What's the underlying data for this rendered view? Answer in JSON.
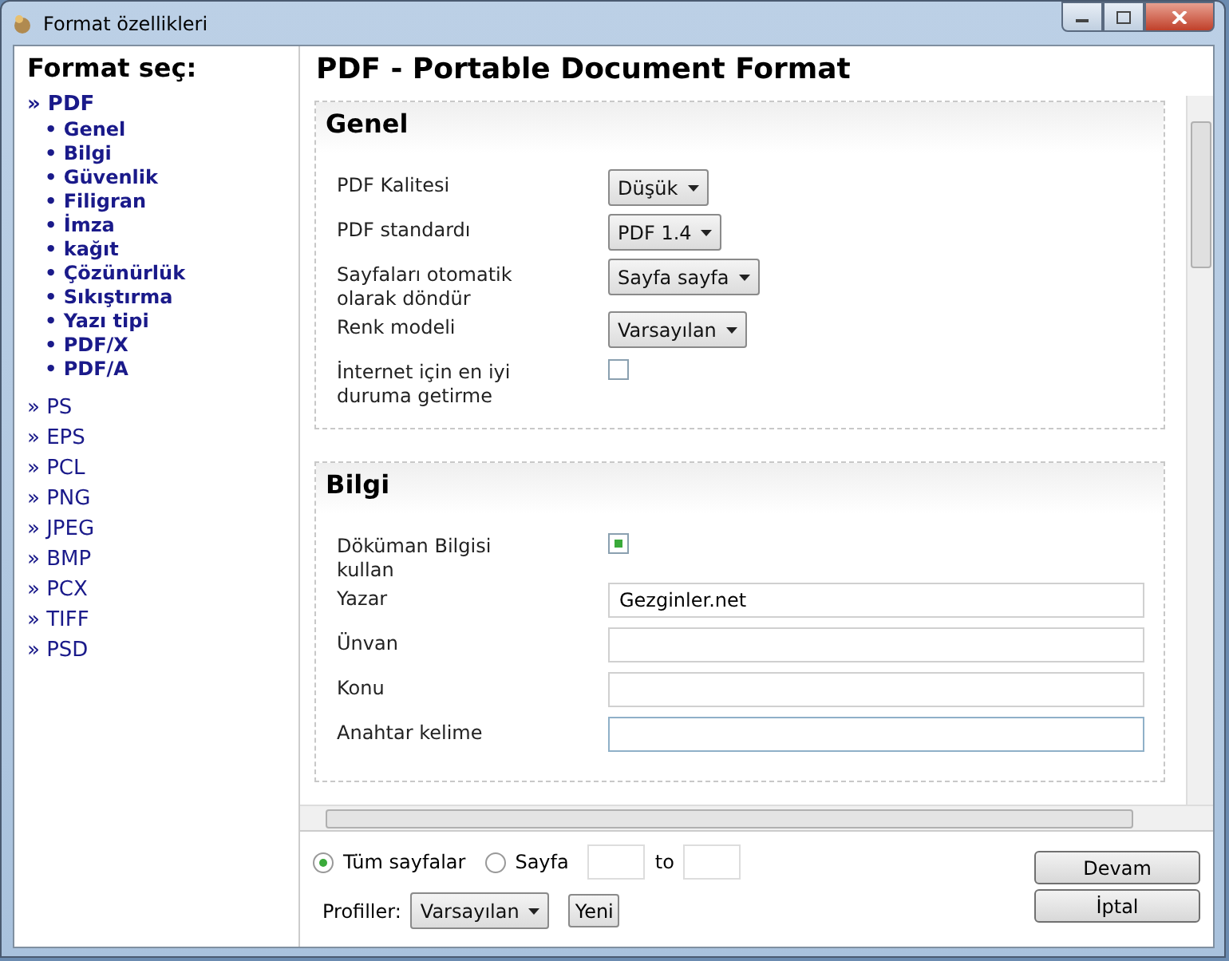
{
  "window": {
    "title": "Format özellikleri"
  },
  "sidebar": {
    "heading": "Format seç:",
    "formats": [
      {
        "label": "» PDF",
        "selected": true,
        "children": [
          {
            "label": "• Genel"
          },
          {
            "label": "• Bilgi"
          },
          {
            "label": "• Güvenlik"
          },
          {
            "label": "• Filigran"
          },
          {
            "label": "• İmza"
          },
          {
            "label": "• kağıt"
          },
          {
            "label": "• Çözünürlük"
          },
          {
            "label": "• Sıkıştırma"
          },
          {
            "label": "• Yazı tipi"
          },
          {
            "label": "• PDF/X"
          },
          {
            "label": "• PDF/A"
          }
        ]
      },
      {
        "label": "» PS",
        "selected": false
      },
      {
        "label": "» EPS",
        "selected": false
      },
      {
        "label": "» PCL",
        "selected": false
      },
      {
        "label": "» PNG",
        "selected": false
      },
      {
        "label": "» JPEG",
        "selected": false
      },
      {
        "label": "» BMP",
        "selected": false
      },
      {
        "label": "» PCX",
        "selected": false
      },
      {
        "label": "» TIFF",
        "selected": false
      },
      {
        "label": "» PSD",
        "selected": false
      }
    ]
  },
  "main": {
    "title": "PDF - Portable Document Format",
    "sections": [
      {
        "title": "Genel",
        "fields": [
          {
            "kind": "select",
            "label": "PDF Kalitesi",
            "value": "Düşük"
          },
          {
            "kind": "select",
            "label": "PDF standardı",
            "value": "PDF 1.4"
          },
          {
            "kind": "select",
            "label": "Sayfaları otomatik olarak döndür",
            "value": "Sayfa sayfa"
          },
          {
            "kind": "select",
            "label": "Renk modeli",
            "value": "Varsayılan"
          },
          {
            "kind": "checkbox",
            "label": "İnternet için en iyi duruma getirme",
            "checked": false
          }
        ]
      },
      {
        "title": "Bilgi",
        "fields": [
          {
            "kind": "checkbox",
            "label": "Döküman Bilgisi kullan",
            "checked": true
          },
          {
            "kind": "text",
            "label": "Yazar",
            "value": "Gezginler.net"
          },
          {
            "kind": "text",
            "label": "Ünvan"
          },
          {
            "kind": "text",
            "label": "Konu"
          },
          {
            "kind": "text",
            "label": "Anahtar kelime",
            "focused": true
          }
        ]
      }
    ]
  },
  "bottom": {
    "page_options": [
      {
        "label": "Tüm sayfalar",
        "selected": true
      },
      {
        "label": "Sayfa",
        "selected": false
      }
    ],
    "range_to": "to",
    "profiles_label": "Profiller:",
    "profile": "Varsayılan",
    "new_button": "Yeni",
    "buttons": [
      "Devam",
      "İptal"
    ]
  }
}
